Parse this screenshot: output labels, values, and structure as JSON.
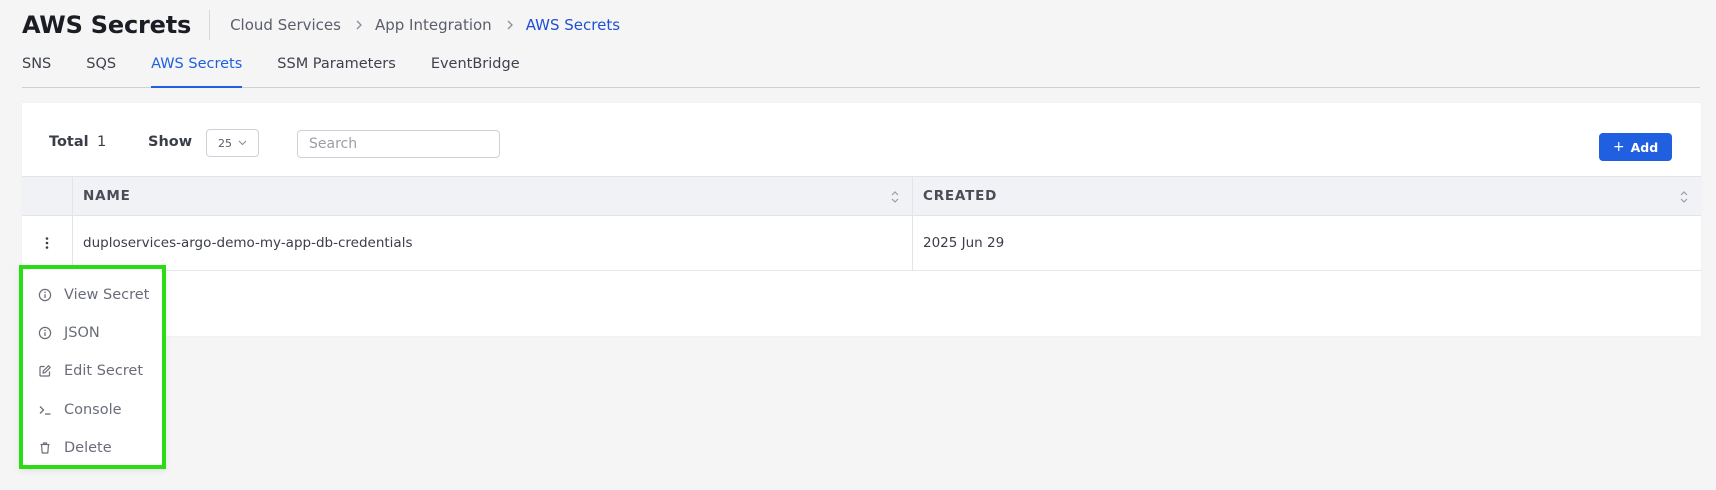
{
  "header": {
    "title": "AWS Secrets",
    "breadcrumb": [
      "Cloud Services",
      "App Integration",
      "AWS Secrets"
    ]
  },
  "tabs": [
    {
      "label": "SNS",
      "active": false
    },
    {
      "label": "SQS",
      "active": false
    },
    {
      "label": "AWS Secrets",
      "active": true
    },
    {
      "label": "SSM Parameters",
      "active": false
    },
    {
      "label": "EventBridge",
      "active": false
    }
  ],
  "toolbar": {
    "total_label": "Total",
    "total_value": "1",
    "show_label": "Show",
    "page_size": "25",
    "search_placeholder": "Search",
    "search_value": "",
    "add_label": "Add"
  },
  "table": {
    "columns": [
      "NAME",
      "CREATED"
    ],
    "rows": [
      {
        "name": "duploservices-argo-demo-my-app-db-credentials",
        "created": "2025 Jun 29"
      }
    ]
  },
  "context_menu": {
    "items": [
      {
        "label": "View Secret",
        "icon": "info-icon"
      },
      {
        "label": "JSON",
        "icon": "info-icon"
      },
      {
        "label": "Edit Secret",
        "icon": "edit-icon"
      },
      {
        "label": "Console",
        "icon": "terminal-icon"
      },
      {
        "label": "Delete",
        "icon": "trash-icon"
      }
    ],
    "highlight_color": "#2cdc13"
  },
  "colors": {
    "accent": "#1f5fe0",
    "breadcrumb_current": "#1f4fd6",
    "background": "#f5f5f6"
  }
}
